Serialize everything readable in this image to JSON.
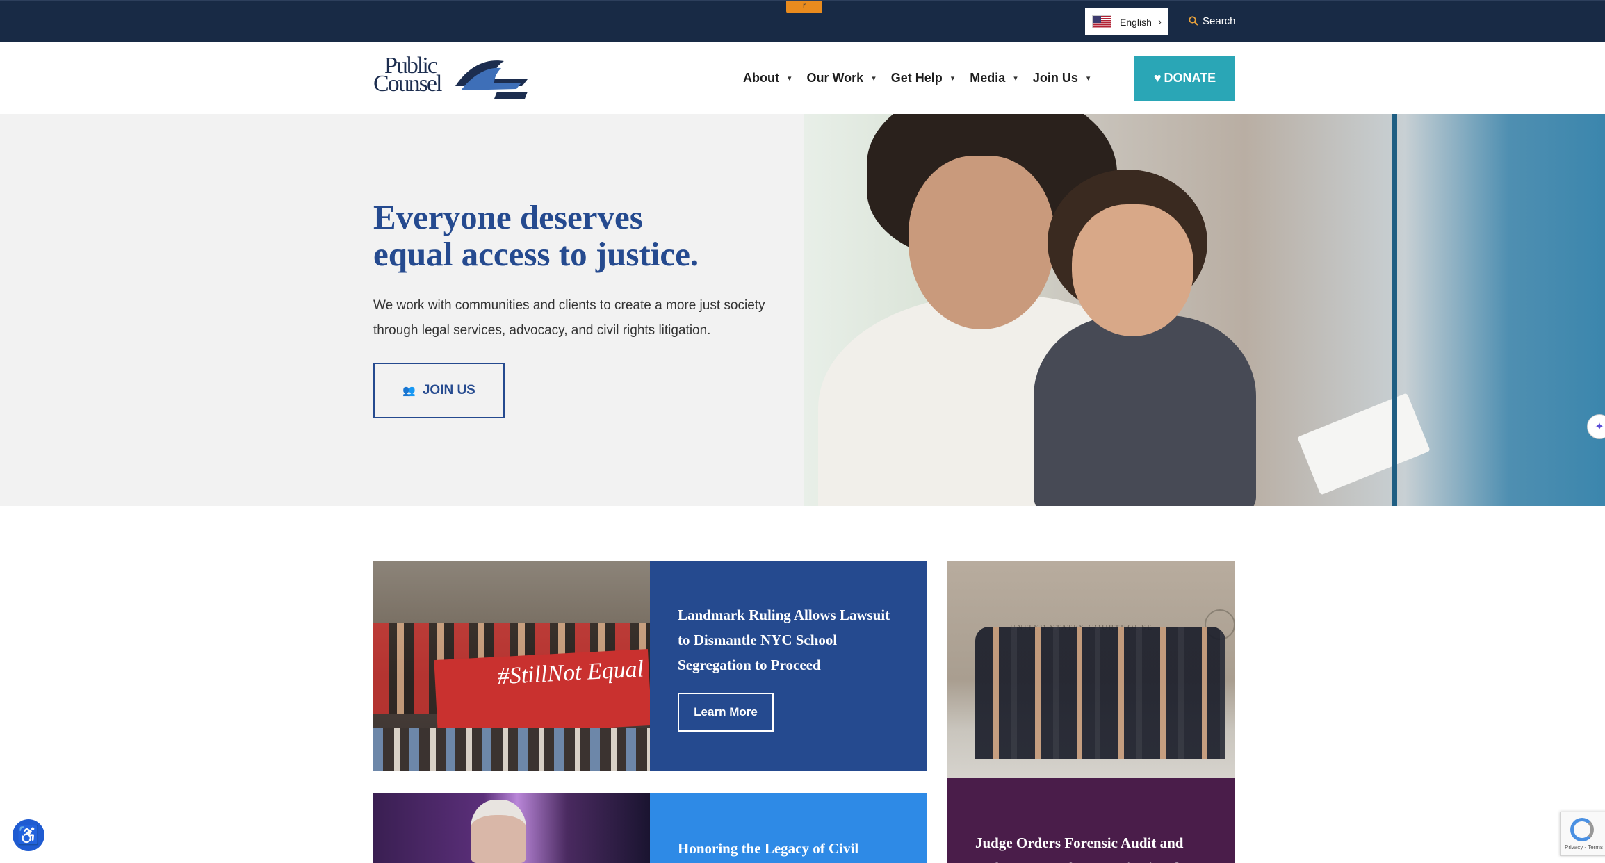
{
  "topbar": {
    "skip_label": "r",
    "language": {
      "label": "English",
      "flag": "us-flag-icon"
    },
    "search_label": "Search"
  },
  "header": {
    "logo_line1": "Public",
    "logo_line2": "Counsel",
    "nav": [
      {
        "label": "About"
      },
      {
        "label": "Our Work"
      },
      {
        "label": "Get Help"
      },
      {
        "label": "Media"
      },
      {
        "label": "Join Us"
      }
    ],
    "donate_label": "DONATE"
  },
  "hero": {
    "title_line1": "Everyone deserves",
    "title_line2": "equal access to justice.",
    "subtitle": "We work with communities and clients to create a more just society through legal services, advocacy, and civil rights litigation.",
    "cta_label": "JOIN US"
  },
  "cards": {
    "card1": {
      "title": "Landmark Ruling Allows Lawsuit to Dismantle NYC School Segregation to Proceed",
      "button": "Learn More",
      "banner_text": "#StillNot Equal",
      "color": "#254a8f"
    },
    "card2": {
      "title": "Judge Orders Forensic Audit and Enforcement of Unconstitutional",
      "sign_text": "UNITED STATES COURTHOUSE",
      "color": "#4a1d4a"
    },
    "card3": {
      "title": "Honoring the Legacy of Civil",
      "color": "#2e8ae6"
    }
  },
  "widgets": {
    "recaptcha_text": "Privacy - Terms"
  },
  "colors": {
    "topbar": "#182a45",
    "brand_blue": "#254a8f",
    "donate": "#2aa6b6"
  }
}
